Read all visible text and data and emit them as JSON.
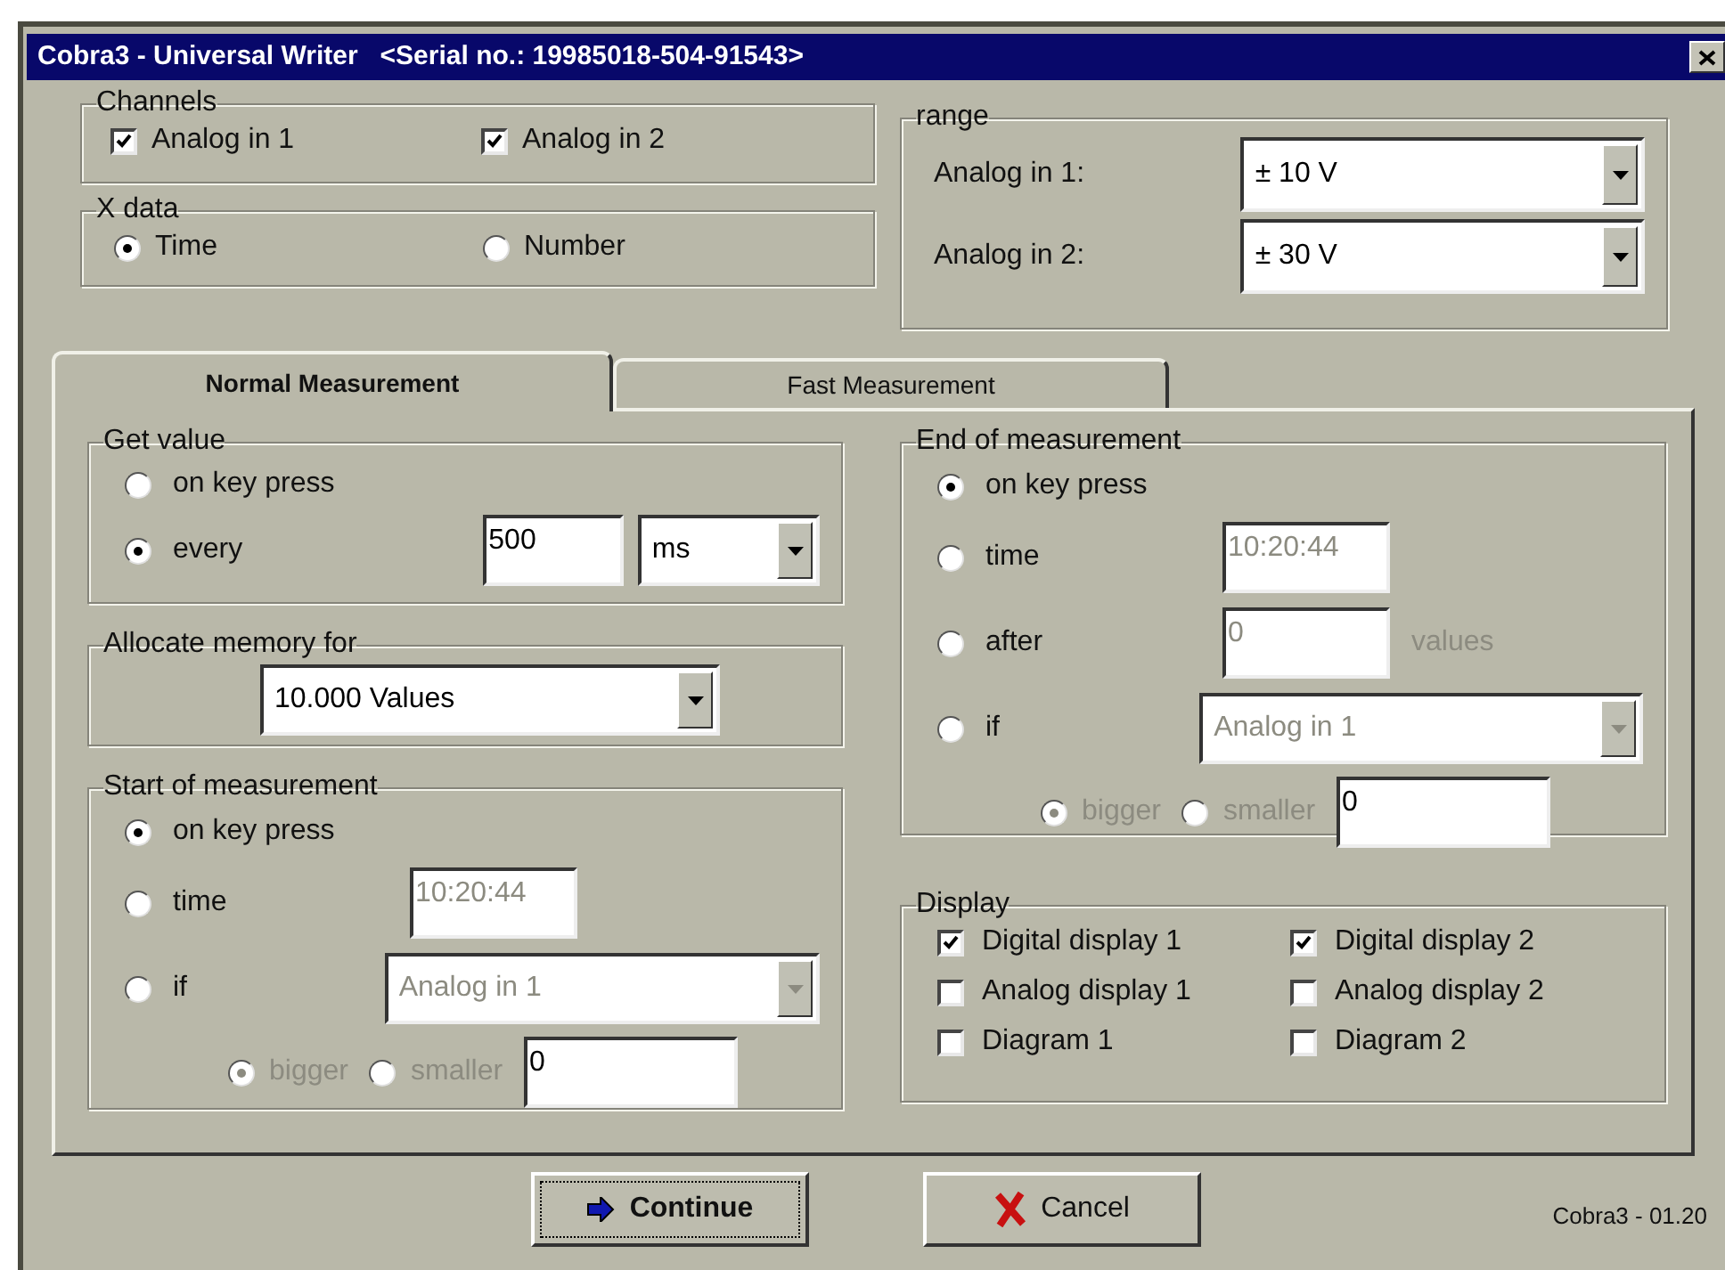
{
  "window": {
    "title": "Cobra3 - Universal Writer   <Serial no.: 19985018-504-91543>"
  },
  "channels": {
    "label": "Channels",
    "items": [
      {
        "label": "Analog in 1",
        "checked": true
      },
      {
        "label": "Analog in 2",
        "checked": true
      }
    ]
  },
  "x_data": {
    "label": "X data",
    "options": [
      {
        "label": "Time",
        "selected": true
      },
      {
        "label": "Number",
        "selected": false
      }
    ]
  },
  "range": {
    "label": "range",
    "rows": [
      {
        "label": "Analog in 1:",
        "value": "± 10 V"
      },
      {
        "label": "Analog in 2:",
        "value": "± 30 V"
      }
    ]
  },
  "tabs": [
    {
      "label": "Normal Measurement",
      "selected": true
    },
    {
      "label": "Fast Measurement",
      "selected": false
    }
  ],
  "get_value": {
    "label": "Get value",
    "options": [
      {
        "kind": "plain",
        "label": "on key press",
        "selected": false
      },
      {
        "kind": "interval",
        "label": "every",
        "selected": true,
        "value": "500",
        "unit": "ms"
      }
    ]
  },
  "allocate_memory": {
    "label": "Allocate memory for",
    "value": "10.000 Values"
  },
  "start_of_measurement": {
    "label": "Start of measurement",
    "options": [
      {
        "kind": "plain",
        "label": "on key press",
        "selected": true
      },
      {
        "kind": "time",
        "label": "time",
        "selected": false,
        "value": "10:20:44",
        "disabled": true
      },
      {
        "kind": "condition",
        "label": "if",
        "selected": false,
        "value": "Analog in 1",
        "disabled": true
      }
    ],
    "comparison": {
      "disabled": true,
      "options": [
        {
          "label": "bigger",
          "selected": true
        },
        {
          "label": "smaller",
          "selected": false
        }
      ],
      "threshold": "0"
    }
  },
  "end_of_measurement": {
    "label": "End of measurement",
    "options": [
      {
        "kind": "plain",
        "label": "on key press",
        "selected": true
      },
      {
        "kind": "time",
        "label": "time",
        "selected": false,
        "value": "10:20:44",
        "disabled": true
      },
      {
        "kind": "count",
        "label": "after",
        "selected": false,
        "value": "0",
        "suffix": "values",
        "disabled": true
      },
      {
        "kind": "condition",
        "label": "if",
        "selected": false,
        "value": "Analog in 1",
        "disabled": true
      }
    ],
    "comparison": {
      "disabled": true,
      "options": [
        {
          "label": "bigger",
          "selected": true
        },
        {
          "label": "smaller",
          "selected": false
        }
      ],
      "threshold": "0"
    }
  },
  "display": {
    "label": "Display",
    "items": [
      {
        "label": "Digital display 1",
        "checked": true
      },
      {
        "label": "Digital display 2",
        "checked": true
      },
      {
        "label": "Analog display 1",
        "checked": false
      },
      {
        "label": "Analog display 2",
        "checked": false
      },
      {
        "label": "Diagram 1",
        "checked": false
      },
      {
        "label": "Diagram 2",
        "checked": false
      }
    ]
  },
  "buttons": [
    {
      "kind": "continue",
      "label": "Continue",
      "focused": true
    },
    {
      "kind": "cancel",
      "label": "Cancel",
      "focused": false
    }
  ],
  "version": "Cobra3 - 01.20"
}
